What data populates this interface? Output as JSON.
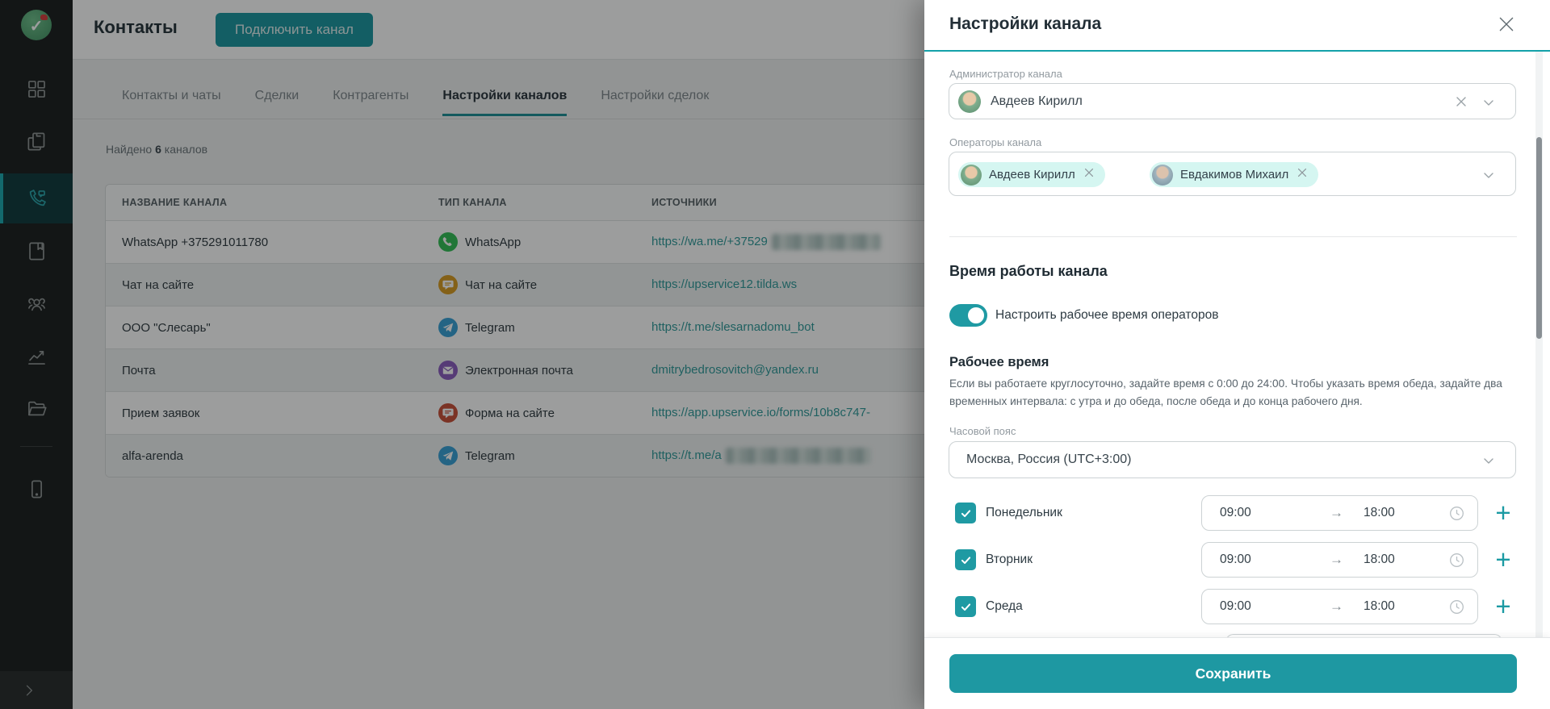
{
  "colors": {
    "accent": "#1b97a0",
    "accent_dark": "#14a1a9",
    "link": "#2f9a9a",
    "chip_bg": "#d5f6f1",
    "sidebar_bg": "#1c1e1e"
  },
  "toolbar": {
    "title": "Контакты",
    "connect_button": "Подключить канал"
  },
  "tabs": {
    "items": [
      {
        "label": "Контакты и чаты"
      },
      {
        "label": "Сделки"
      },
      {
        "label": "Контрагенты"
      },
      {
        "label": "Настройки каналов"
      },
      {
        "label": "Настройки сделок"
      }
    ],
    "active": "Настройки каналов"
  },
  "results": {
    "prefix": "Найдено",
    "count": "6",
    "suffix": "каналов"
  },
  "table": {
    "headers": [
      "НАЗВАНИЕ КАНАЛА",
      "ТИП КАНАЛА",
      "ИСТОЧНИКИ"
    ],
    "rows": [
      {
        "name": "WhatsApp +375291011780",
        "type": "WhatsApp",
        "kind": "whatsapp",
        "url": "https://wa.me/+37529",
        "url_masked": true
      },
      {
        "name": "Чат на сайте",
        "type": "Чат на сайте",
        "kind": "sitechat",
        "url": "https://upservice12.tilda.ws",
        "url_masked": false
      },
      {
        "name": "ООО \"Слесарь\"",
        "type": "Telegram",
        "kind": "telegram",
        "url": "https://t.me/slesarnadomu_bot",
        "url_masked": false
      },
      {
        "name": "Почта",
        "type": "Электронная почта",
        "kind": "email",
        "url": "dmitrybedrosovitch@yandex.ru",
        "url_masked": false
      },
      {
        "name": "Прием заявок",
        "type": "Форма на сайте",
        "kind": "form",
        "url": "https://app.upservice.io/forms/10b8c747-",
        "url_masked": false
      },
      {
        "name": "alfa-arenda",
        "type": "Telegram",
        "kind": "telegram",
        "url": "https://t.me/a",
        "url_masked": true
      }
    ]
  },
  "panel": {
    "title": "Настройки канала",
    "admin": {
      "label": "Администратор канала",
      "value": "Авдеев Кирилл"
    },
    "operators": {
      "label": "Операторы канала",
      "chips": [
        {
          "name": "Авдеев Кирилл"
        },
        {
          "name": "Евдакимов Михаил"
        }
      ]
    },
    "work_hours": {
      "heading": "Время работы канала",
      "toggle_label": "Настроить рабочее время операторов",
      "toggle_on": true,
      "subheading": "Рабочее время",
      "description": "Если вы работаете круглосуточно, задайте время с 0:00 до 24:00. Чтобы указать время обеда, задайте два временных интервала: с утра и до обеда, после обеда и до конца рабочего дня.",
      "timezone": {
        "label": "Часовой пояс",
        "value": "Москва, Россия (UTC+3:00)"
      },
      "days": [
        {
          "label": "Понедельник",
          "from": "09:00",
          "to": "18:00",
          "checked": true
        },
        {
          "label": "Вторник",
          "from": "09:00",
          "to": "18:00",
          "checked": true
        },
        {
          "label": "Среда",
          "from": "09:00",
          "to": "18:00",
          "checked": true
        }
      ]
    },
    "save_button": "Сохранить"
  }
}
